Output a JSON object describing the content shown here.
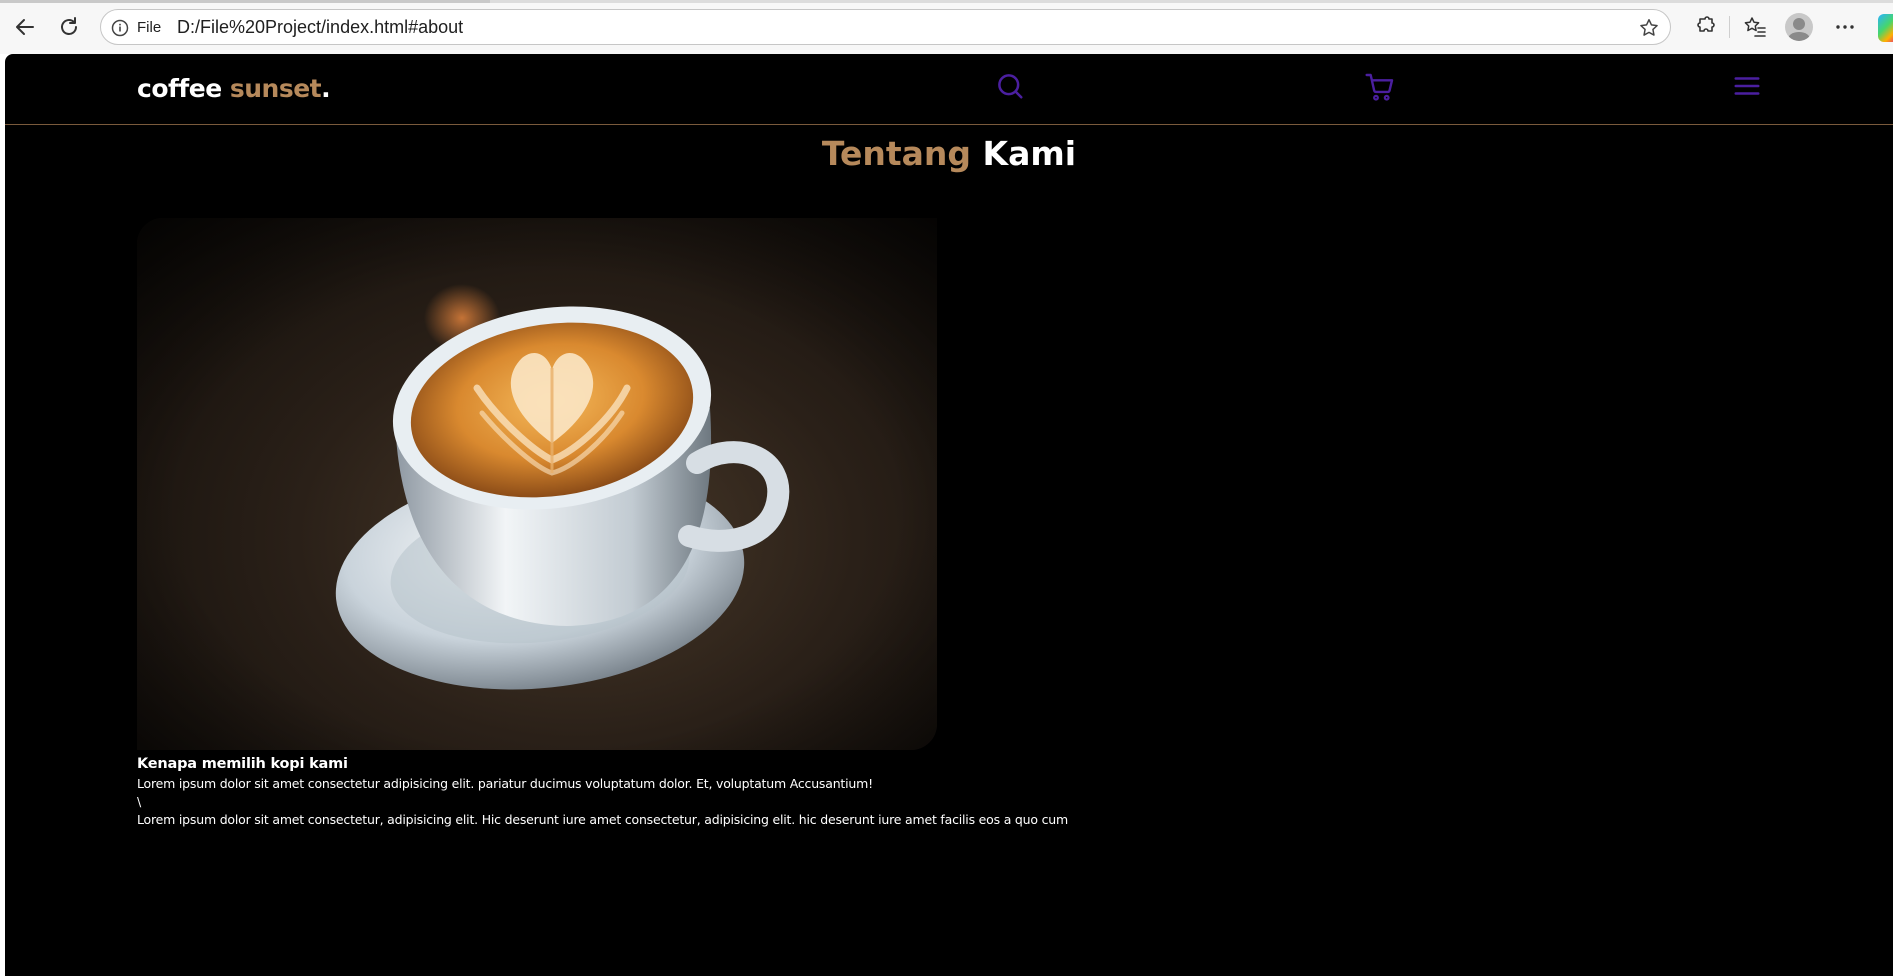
{
  "browser": {
    "scheme_label": "File",
    "url": "D:/File%20Project/index.html#about"
  },
  "site": {
    "logo_main": "coffee ",
    "logo_accent": "sunset",
    "logo_dot": ".",
    "accent_color": "#b6895b",
    "icon_color": "#4b1fa0"
  },
  "about": {
    "title_accent": "Tentang",
    "title_main": " Kami",
    "image_alt": "cappuccino with latte art",
    "heading": "Kenapa memilih kopi kami",
    "paragraphs": [
      "Lorem ipsum dolor sit amet consectetur adipisicing elit. pariatur ducimus voluptatum dolor. Et, voluptatum Accusantium!",
      "\\",
      "Lorem ipsum dolor sit amet consectetur, adipisicing elit. Hic deserunt iure amet consectetur, adipisicing elit. hic deserunt iure amet facilis eos a quo cum"
    ]
  }
}
